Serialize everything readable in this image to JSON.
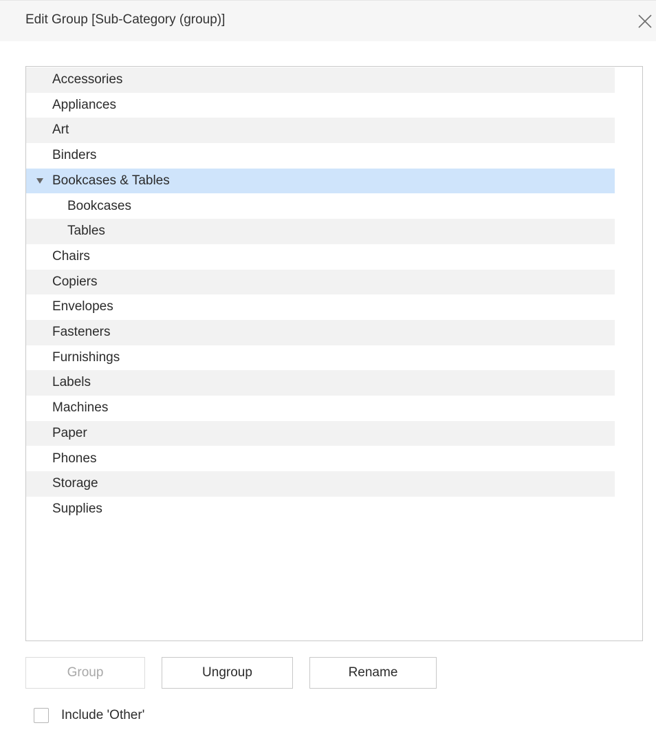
{
  "dialog": {
    "title": "Edit Group [Sub-Category (group)]",
    "close_icon": "close-icon"
  },
  "tree": {
    "items": [
      {
        "label": "Accessories",
        "level": 0
      },
      {
        "label": "Appliances",
        "level": 0
      },
      {
        "label": "Art",
        "level": 0
      },
      {
        "label": "Binders",
        "level": 0
      },
      {
        "label": "Bookcases & Tables",
        "level": 0,
        "expanded": true,
        "selected": true,
        "icon": "caret-down-icon"
      },
      {
        "label": "Bookcases",
        "level": 1
      },
      {
        "label": "Tables",
        "level": 1
      },
      {
        "label": "Chairs",
        "level": 0
      },
      {
        "label": "Copiers",
        "level": 0
      },
      {
        "label": "Envelopes",
        "level": 0
      },
      {
        "label": "Fasteners",
        "level": 0
      },
      {
        "label": "Furnishings",
        "level": 0
      },
      {
        "label": "Labels",
        "level": 0
      },
      {
        "label": "Machines",
        "level": 0
      },
      {
        "label": "Paper",
        "level": 0
      },
      {
        "label": "Phones",
        "level": 0
      },
      {
        "label": "Storage",
        "level": 0
      },
      {
        "label": "Supplies",
        "level": 0
      }
    ]
  },
  "buttons": {
    "group_label": "Group",
    "group_disabled": true,
    "ungroup_label": "Ungroup",
    "rename_label": "Rename"
  },
  "include_other": {
    "label": "Include 'Other'",
    "checked": false
  },
  "colors": {
    "selected_row": "#cfe4fb",
    "alt_row": "#f2f2f2",
    "title_bar": "#f6f6f6"
  }
}
